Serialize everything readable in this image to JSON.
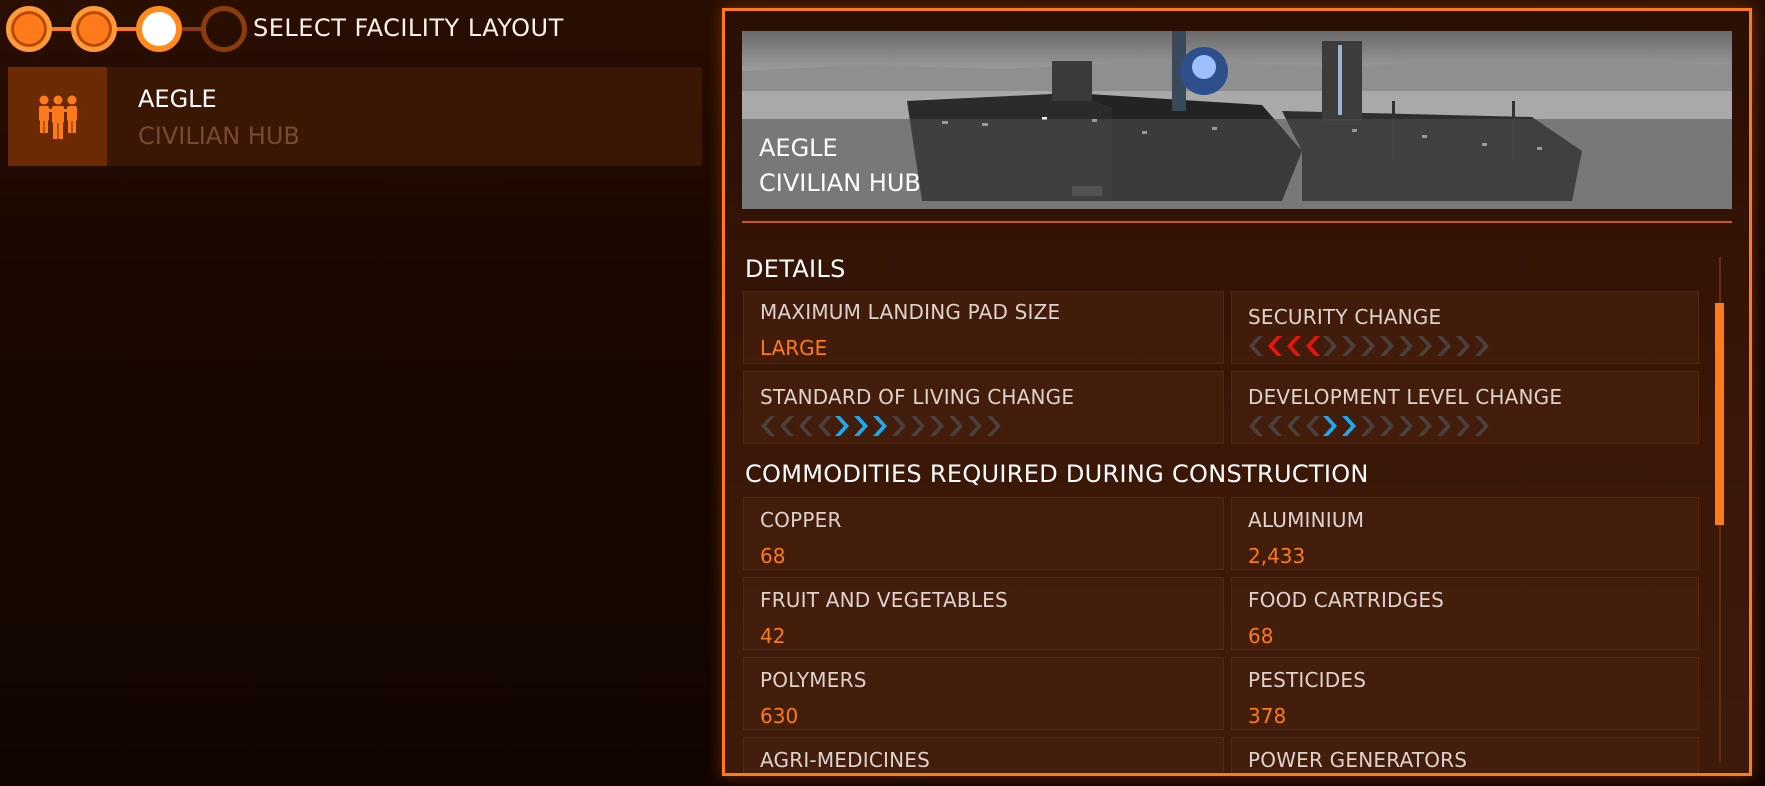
{
  "steps": {
    "title": "SELECT FACILITY LAYOUT",
    "states": [
      "done",
      "done",
      "active",
      "pending"
    ]
  },
  "layout_item": {
    "name": "AEGLE",
    "type": "CIVILIAN HUB",
    "icon": "people-icon"
  },
  "preview": {
    "name": "AEGLE",
    "type": "CIVILIAN HUB"
  },
  "details": {
    "title": "DETAILS",
    "landing_pad": {
      "label": "MAXIMUM LANDING PAD SIZE",
      "value": "LARGE"
    },
    "security": {
      "label": "SECURITY CHANGE",
      "direction": "decrease",
      "level": 3,
      "color": "#e8140c"
    },
    "standard_of_living": {
      "label": "STANDARD OF LIVING CHANGE",
      "direction": "increase",
      "level": 3,
      "color": "#1ea8f0"
    },
    "development": {
      "label": "DEVELOPMENT LEVEL CHANGE",
      "direction": "increase",
      "level": 2,
      "color": "#1ea8f0"
    }
  },
  "commodities": {
    "title": "COMMODITIES REQUIRED DURING CONSTRUCTION",
    "items": [
      {
        "name": "COPPER",
        "qty": "68"
      },
      {
        "name": "ALUMINIUM",
        "qty": "2,433"
      },
      {
        "name": "FRUIT AND VEGETABLES",
        "qty": "42"
      },
      {
        "name": "FOOD CARTRIDGES",
        "qty": "68"
      },
      {
        "name": "POLYMERS",
        "qty": "630"
      },
      {
        "name": "PESTICIDES",
        "qty": "378"
      },
      {
        "name": "AGRI-MEDICINES",
        "qty": ""
      },
      {
        "name": "POWER GENERATORS",
        "qty": ""
      }
    ]
  },
  "colors": {
    "accent": "#ff7a1a",
    "inactive_chevron": "#4a403c"
  }
}
